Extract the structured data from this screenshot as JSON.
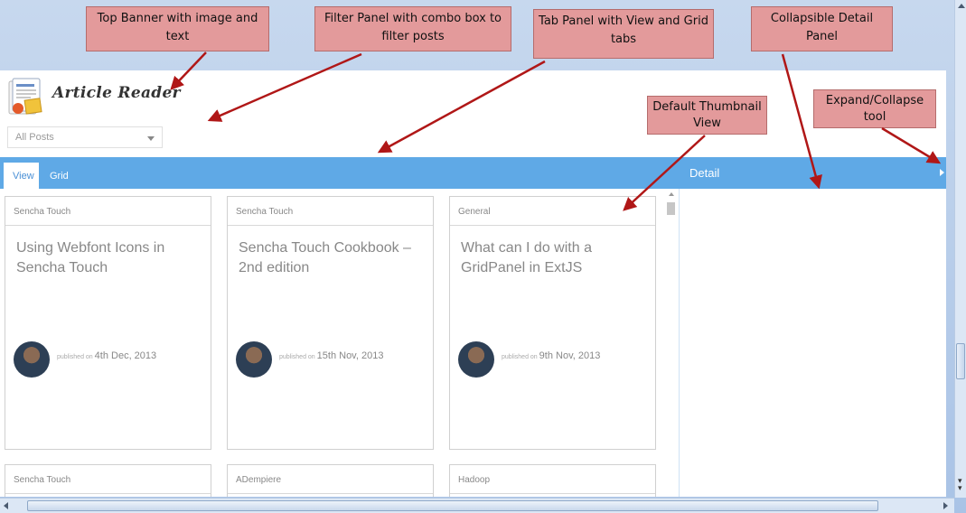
{
  "app": {
    "title": "Article Reader",
    "filter": {
      "value": "All Posts"
    },
    "tabs": [
      {
        "label": "View",
        "active": true
      },
      {
        "label": "Grid",
        "active": false
      }
    ],
    "detail": {
      "title": "Detail"
    }
  },
  "cards": [
    {
      "category": "Sencha Touch",
      "title": "Using Webfont Icons in Sencha Touch",
      "published_label": "published on",
      "date": "4th Dec, 2013"
    },
    {
      "category": "Sencha Touch",
      "title": "Sencha Touch Cookbook – 2nd edition",
      "published_label": "published on",
      "date": "15th Nov, 2013"
    },
    {
      "category": "General",
      "title": "What can I do with a GridPanel in ExtJS",
      "published_label": "published on",
      "date": "9th Nov, 2013"
    },
    {
      "category": "Sencha Touch"
    },
    {
      "category": "ADempiere"
    },
    {
      "category": "Hadoop"
    }
  ],
  "annotations": [
    {
      "text": "Top Banner with image and text"
    },
    {
      "text": "Filter Panel with combo box to filter posts"
    },
    {
      "text": "Tab Panel with View and Grid tabs"
    },
    {
      "text": "Collapsible Detail Panel"
    },
    {
      "text": "Default Thumbnail View"
    },
    {
      "text": "Expand/Collapse tool"
    }
  ],
  "colors": {
    "tabbar": "#5fa9e6",
    "callout": "#e39a9b",
    "arrow": "#b01717"
  },
  "icons": {
    "logo": "article-reader-logo-icon",
    "combo": "chevron-down-icon",
    "collapse": "triangle-right-icon"
  }
}
